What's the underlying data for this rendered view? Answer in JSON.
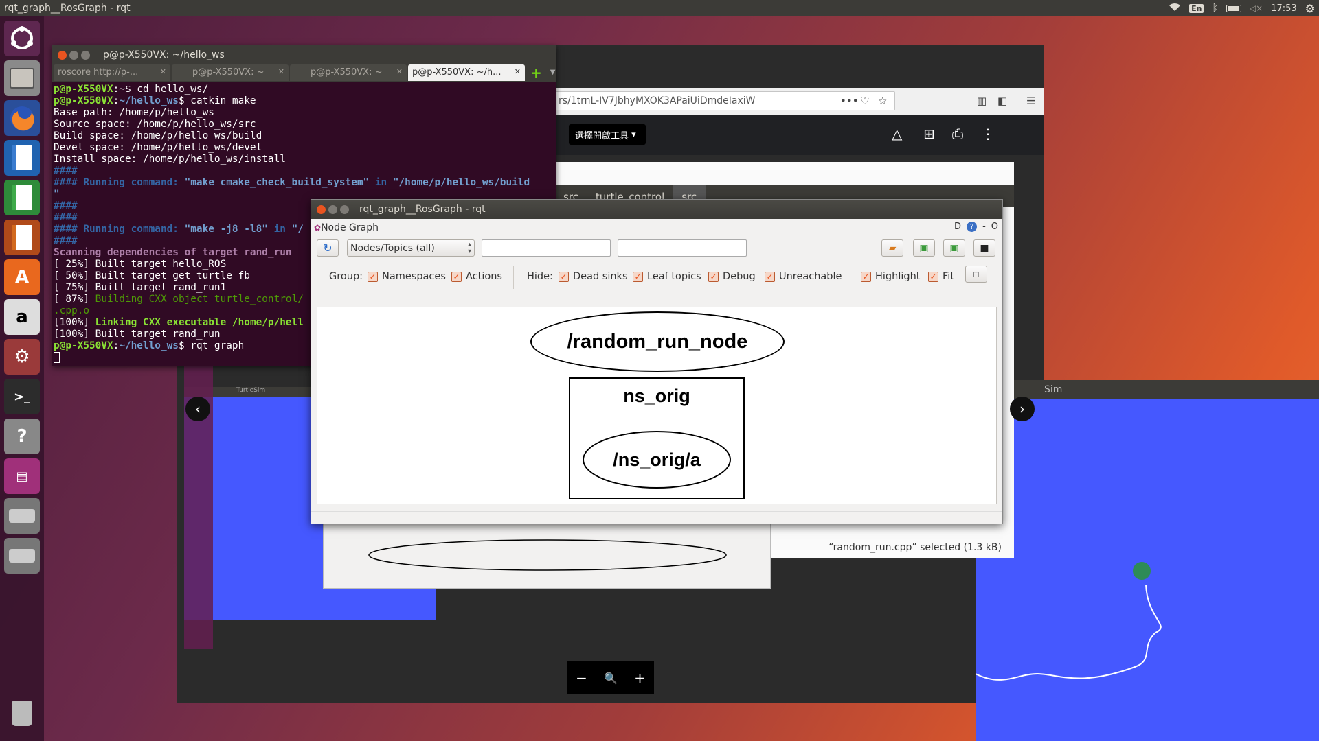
{
  "topbar": {
    "title": "rqt_graph__RosGraph - rqt",
    "lang": "En",
    "volume_icon": "◁×",
    "clock": "17:53"
  },
  "launcher": {
    "items": [
      "ubuntu-dash",
      "files",
      "firefox",
      "writer",
      "calc",
      "impress",
      "software-center",
      "amazon",
      "system-settings",
      "terminal",
      "help",
      "rqt",
      "drive",
      "drive"
    ],
    "trash": "trash"
  },
  "terminal": {
    "title": "p@p-X550VX: ~/hello_ws",
    "tabs": [
      {
        "label": "roscore http://p-..."
      },
      {
        "label": "p@p-X550VX: ~"
      },
      {
        "label": "p@p-X550VX: ~"
      },
      {
        "label": "p@p-X550VX: ~/h..."
      }
    ],
    "lines": [
      [
        {
          "t": "p@p-X550VX",
          "c": "g"
        },
        {
          "t": ":~$ cd hello_ws/",
          "c": ""
        }
      ],
      [
        {
          "t": "p@p-X550VX",
          "c": "g"
        },
        {
          "t": ":",
          "c": ""
        },
        {
          "t": "~/hello_ws",
          "c": "b"
        },
        {
          "t": "$ catkin_make",
          "c": ""
        }
      ],
      [
        {
          "t": "Base path: /home/p/hello_ws",
          "c": ""
        }
      ],
      [
        {
          "t": "Source space: /home/p/hello_ws/src",
          "c": ""
        }
      ],
      [
        {
          "t": "Build space: /home/p/hello_ws/build",
          "c": ""
        }
      ],
      [
        {
          "t": "Devel space: /home/p/hello_ws/devel",
          "c": ""
        }
      ],
      [
        {
          "t": "Install space: /home/p/hello_ws/install",
          "c": ""
        }
      ],
      [
        {
          "t": "####",
          "c": "bl"
        }
      ],
      [
        {
          "t": "#### Running command: ",
          "c": "bl"
        },
        {
          "t": "\"make cmake_check_build_system\"",
          "c": "b"
        },
        {
          "t": " in ",
          "c": "bl"
        },
        {
          "t": "\"/home/p/hello_ws/build",
          "c": "b"
        }
      ],
      [
        {
          "t": "\"",
          "c": "b"
        }
      ],
      [
        {
          "t": "####",
          "c": "bl"
        }
      ],
      [
        {
          "t": "####",
          "c": "bl"
        }
      ],
      [
        {
          "t": "#### Running command: ",
          "c": "bl"
        },
        {
          "t": "\"make -j8 -l8\"",
          "c": "b"
        },
        {
          "t": " in ",
          "c": "bl"
        },
        {
          "t": "\"/",
          "c": "b"
        }
      ],
      [
        {
          "t": "####",
          "c": "bl"
        }
      ],
      [
        {
          "t": "Scanning dependencies of target rand_run",
          "c": "m"
        }
      ],
      [
        {
          "t": "[ 25%] Built target hello_ROS",
          "c": ""
        }
      ],
      [
        {
          "t": "[ 50%] Built target get_turtle_fb",
          "c": ""
        }
      ],
      [
        {
          "t": "[ 75%] Built target rand_run1",
          "c": ""
        }
      ],
      [
        {
          "t": "[ 87%] ",
          "c": ""
        },
        {
          "t": "Building CXX object turtle_control/",
          "c": "gn"
        }
      ],
      [
        {
          "t": ".cpp.o",
          "c": "gn"
        }
      ],
      [
        {
          "t": "[100%] ",
          "c": ""
        },
        {
          "t": "Linking CXX executable /home/p/hell",
          "c": "g"
        }
      ],
      [
        {
          "t": "[100%] Built target rand_run",
          "c": ""
        }
      ],
      [
        {
          "t": "p@p-X550VX",
          "c": "g"
        },
        {
          "t": ":",
          "c": ""
        },
        {
          "t": "~/hello_ws",
          "c": "b"
        },
        {
          "t": "$ rqt_graph",
          "c": ""
        }
      ]
    ]
  },
  "firefox": {
    "url": "rs/1trnL-IV7JbhyMXOK3APaiUiDmdeIaxiW",
    "open_with": "選擇開啟工具"
  },
  "filemanager": {
    "tabs": [
      "src",
      "turtle_control",
      "src"
    ],
    "status": "“random_run.cpp” selected  (1.3 kB)"
  },
  "turtlesim": {
    "title_small": "TurtleSim",
    "title_large": "Sim"
  },
  "rqt": {
    "title": "rqt_graph__RosGraph - rqt",
    "plugin_title": "Node Graph",
    "plugin_controls": [
      "D",
      "?",
      "-",
      "O"
    ],
    "combo_value": "Nodes/Topics (all)",
    "group_label": "Group:",
    "hide_label": "Hide:",
    "options": {
      "namespaces": "Namespaces",
      "actions": "Actions",
      "dead_sinks": "Dead sinks",
      "leaf_topics": "Leaf topics",
      "debug": "Debug",
      "unreachable": "Unreachable",
      "highlight": "Highlight",
      "fit": "Fit"
    },
    "graph": {
      "node1": "/random_run_node",
      "cluster": "ns_orig",
      "node2": "/ns_orig/a"
    }
  },
  "zoom": {
    "minus": "−",
    "zoom_icon": "🔍",
    "plus": "+"
  }
}
